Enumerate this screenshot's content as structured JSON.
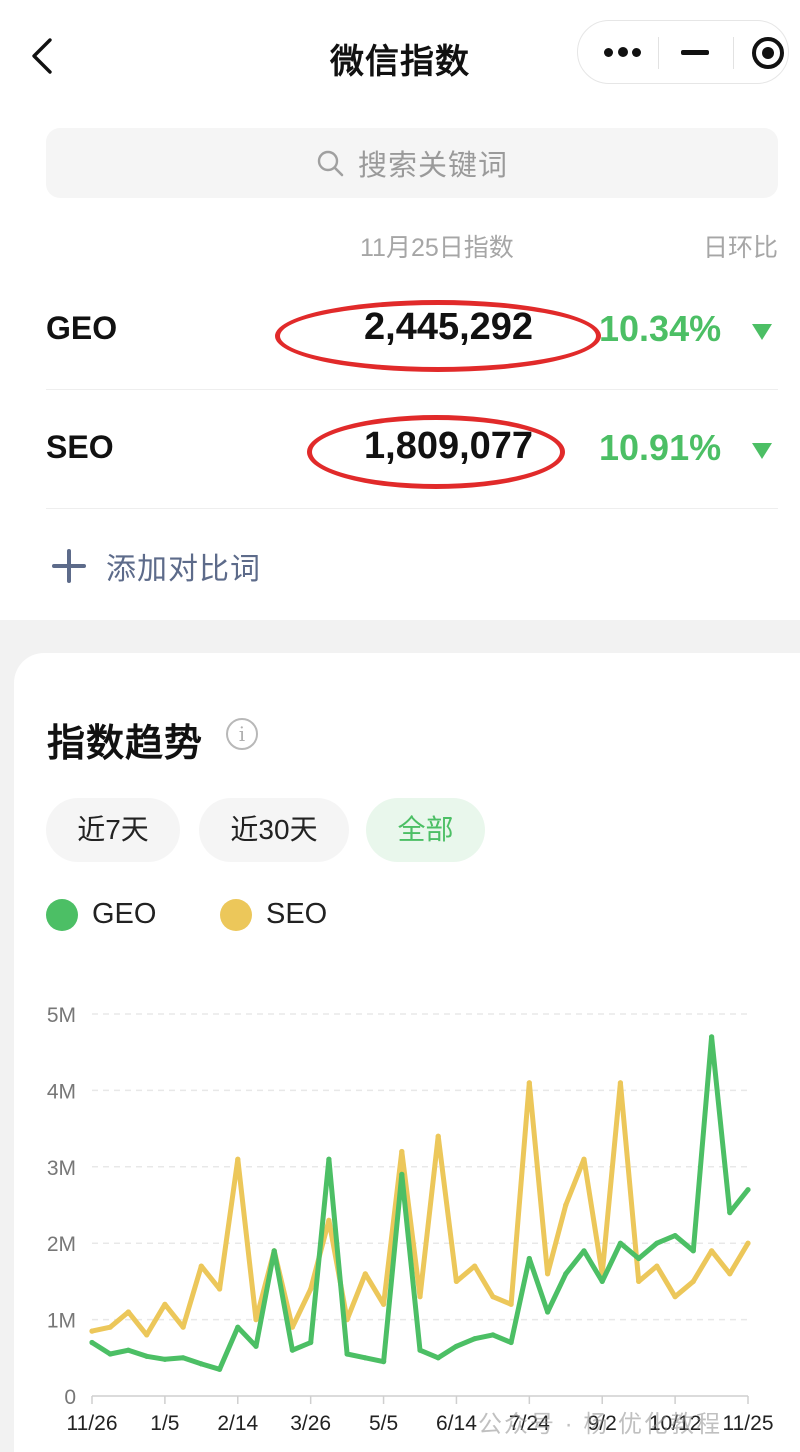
{
  "nav": {
    "title": "微信指数"
  },
  "search": {
    "placeholder": "搜索关键词"
  },
  "index_table": {
    "date_header": "11月25日指数",
    "ratio_header": "日环比",
    "rows": [
      {
        "keyword": "GEO",
        "value": "2,445,292",
        "change": "10.34%",
        "direction": "down"
      },
      {
        "keyword": "SEO",
        "value": "1,809,077",
        "change": "10.91%",
        "direction": "down"
      }
    ]
  },
  "add_compare": {
    "label": "添加对比词"
  },
  "trend": {
    "title": "指数趋势",
    "tabs": [
      {
        "label": "近7天",
        "selected": false
      },
      {
        "label": "近30天",
        "selected": false
      },
      {
        "label": "全部",
        "selected": true
      }
    ]
  },
  "colors": {
    "geo": "#4cbf65",
    "seo": "#ecc75a",
    "accent_green": "#4cbf65",
    "annotation_red": "#e12a2a"
  },
  "watermark": "公众号 · 杨 优化教程",
  "chart_data": {
    "type": "line",
    "ylim": [
      0,
      5000000
    ],
    "yticks": [
      "0",
      "1M",
      "2M",
      "3M",
      "4M",
      "5M"
    ],
    "xticks": [
      "11/26",
      "1/5",
      "2/14",
      "3/26",
      "5/5",
      "6/14",
      "7/24",
      "9/2",
      "10/12",
      "11/25"
    ],
    "x": [
      "11/26",
      "12/6",
      "12/16",
      "12/26",
      "1/5",
      "1/15",
      "1/25",
      "2/4",
      "2/14",
      "2/24",
      "3/6",
      "3/16",
      "3/26",
      "4/5",
      "4/15",
      "4/25",
      "5/5",
      "5/15",
      "5/25",
      "6/4",
      "6/14",
      "6/24",
      "7/4",
      "7/14",
      "7/24",
      "8/3",
      "8/13",
      "8/23",
      "9/2",
      "9/12",
      "9/22",
      "10/2",
      "10/12",
      "10/22",
      "11/1",
      "11/11",
      "11/25"
    ],
    "series": [
      {
        "name": "GEO",
        "values": [
          700000,
          550000,
          600000,
          520000,
          480000,
          500000,
          420000,
          350000,
          900000,
          650000,
          1900000,
          600000,
          700000,
          3100000,
          550000,
          500000,
          450000,
          2900000,
          600000,
          500000,
          650000,
          750000,
          800000,
          700000,
          1800000,
          1100000,
          1600000,
          1900000,
          1500000,
          2000000,
          1800000,
          2000000,
          2100000,
          1900000,
          4700000,
          2400000,
          2700000
        ]
      },
      {
        "name": "SEO",
        "values": [
          850000,
          900000,
          1100000,
          800000,
          1200000,
          900000,
          1700000,
          1400000,
          3100000,
          1000000,
          1900000,
          900000,
          1400000,
          2300000,
          1000000,
          1600000,
          1200000,
          3200000,
          1300000,
          3400000,
          1500000,
          1700000,
          1300000,
          1200000,
          4100000,
          1600000,
          2500000,
          3100000,
          1600000,
          4100000,
          1500000,
          1700000,
          1300000,
          1500000,
          1900000,
          1600000,
          2000000
        ]
      }
    ]
  }
}
